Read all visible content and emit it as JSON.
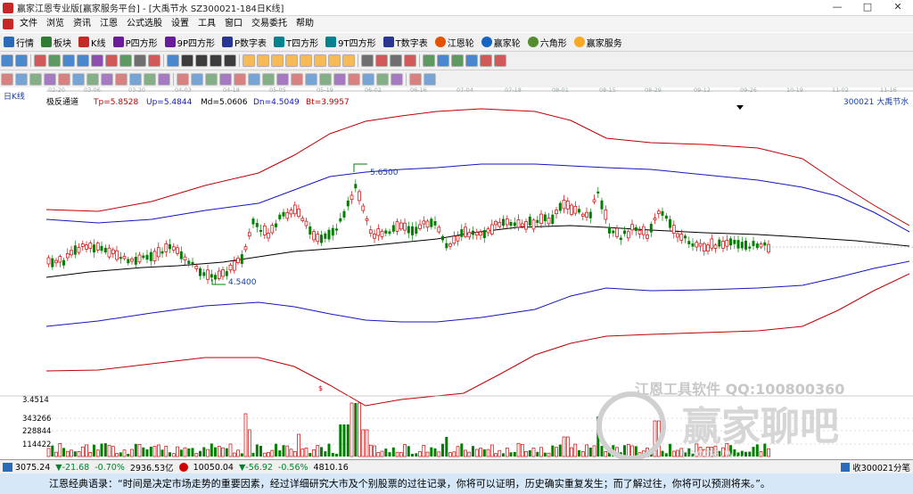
{
  "window": {
    "title": "赢家江恩专业版[赢家服务平台] - [大禹节水  SZ300021-184日K线]",
    "min": "—",
    "max": "□",
    "close": "✕"
  },
  "menu": [
    "文件",
    "浏览",
    "资讯",
    "江恩",
    "公式选股",
    "设置",
    "工具",
    "窗口",
    "交易委托",
    "帮助"
  ],
  "toolbar1": [
    "行情",
    "板块",
    "K线",
    "P四方形",
    "9P四方形",
    "P数字表",
    "T四方形",
    "9T四方形",
    "T数字表",
    "江恩轮",
    "赢家轮",
    "六角形",
    "赢家服务"
  ],
  "chart": {
    "period": "日K线",
    "indicator": "极反通道",
    "tp": "Tp=5.8528",
    "up": "Up=5.4844",
    "md": "Md=5.0606",
    "dn": "Dn=4.5049",
    "bt": "Bt=3.9957",
    "stock": "300021  大禹节水",
    "high_label": "5.6500",
    "low_label": "4.5400",
    "dates": [
      "02-20",
      "03-06",
      "03-20",
      "04-03",
      "04-18",
      "05-05",
      "05-19",
      "06-02",
      "06-16",
      "07-04",
      "07-18",
      "08-01",
      "08-15",
      "08-29",
      "09-12",
      "09-26",
      "10-19",
      "11-02",
      "11-16"
    ],
    "vol_ticks": [
      "3.4514",
      "343266",
      "228844",
      "114422"
    ],
    "vol_marker": "$",
    "colors": {
      "up": "#d00000",
      "down": "#008000",
      "tp": "#c00000",
      "up_band": "#1515c0",
      "mid": "#000000"
    }
  },
  "status": {
    "sh_index": "3075.24",
    "sh_change": "▼-21.68",
    "sh_pct": "-0.70%",
    "sh_amount": "2936.53亿",
    "sz_index": "10050.04",
    "sz_change": "▼-56.92",
    "sz_pct": "-0.56%",
    "sz_amount": "4810.16",
    "right": "收300021分笔"
  },
  "watermark": {
    "line1": "江恩工具软件  QQ:100800360",
    "line2": "赢家聊吧",
    "line3": "jiaoba.w..."
  },
  "quote": "江恩经典语录：“时间是决定市场走势的重要因素，经过详细研究大市及个别股票的过往记录，你将可以证明，历史确实重复发生；而了解过往，你将可以预测将来。”。"
}
